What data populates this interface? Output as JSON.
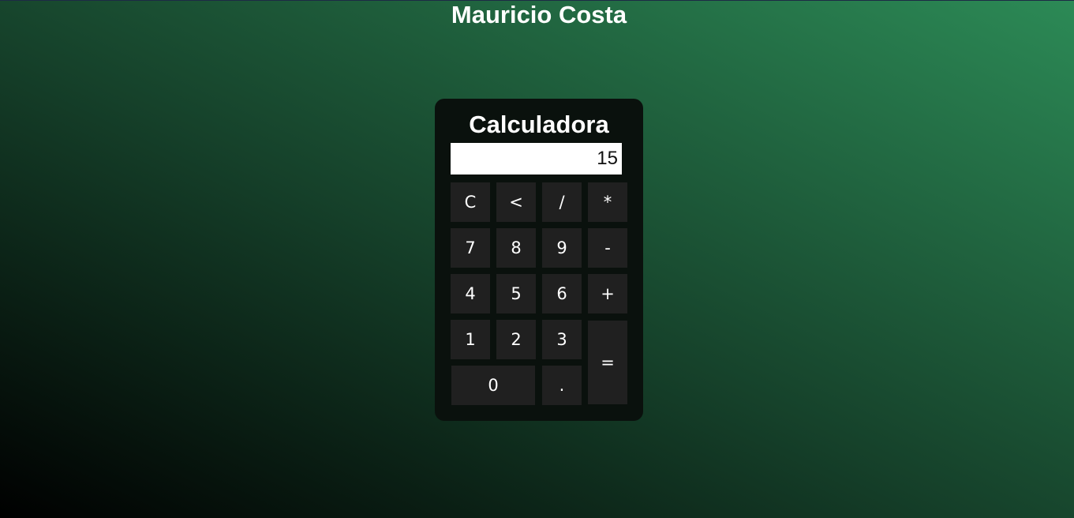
{
  "page": {
    "title": "Mauricio Costa"
  },
  "calculator": {
    "title": "Calculadora",
    "display_value": "15",
    "keys": {
      "clear": "C",
      "backspace": "<",
      "divide": "/",
      "multiply": "*",
      "seven": "7",
      "eight": "8",
      "nine": "9",
      "minus": "-",
      "four": "4",
      "five": "5",
      "six": "6",
      "plus": "+",
      "one": "1",
      "two": "2",
      "three": "3",
      "equals": "=",
      "zero": "0",
      "decimal": "."
    }
  },
  "colors": {
    "gradient_start": "#000000",
    "gradient_end": "#2c8a56",
    "panel": "#0a110d",
    "key": "#202020",
    "text": "#ffffff"
  }
}
